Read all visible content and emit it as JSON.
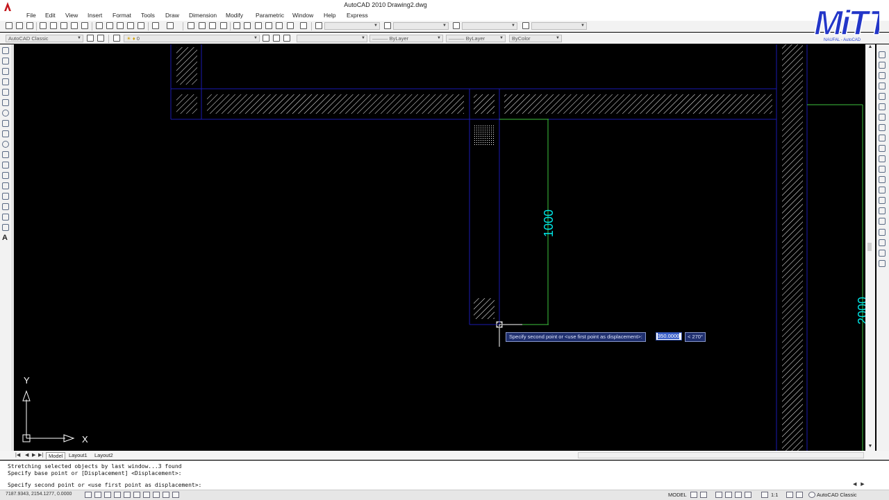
{
  "window": {
    "title": "AutoCAD 2010    Drawing2.dwg"
  },
  "menu": [
    "File",
    "Edit",
    "View",
    "Insert",
    "Format",
    "Tools",
    "Draw",
    "Dimension",
    "Modify",
    "Parametric",
    "Window",
    "Help",
    "Express"
  ],
  "toolbar": {
    "workspace": "AutoCAD Classic",
    "layer": "0",
    "linetype1": "ByLayer",
    "linetype2": "ByLayer",
    "color": "ByColor"
  },
  "logo": {
    "text": "MiTT",
    "subtitle": "NAUFAL - AutoCAD"
  },
  "drawing": {
    "dim_vertical": "1000",
    "dim_right": "2000",
    "ucs_x": "X",
    "ucs_y": "Y"
  },
  "dynamic_input": {
    "prompt": "Specify second point or <use first point as displacement>:",
    "distance": "350.0000",
    "angle": "< 270°"
  },
  "tabs": [
    "Model",
    "Layout1",
    "Layout2"
  ],
  "command_history": [
    "Stretching selected objects by last window...3 found",
    "Specify base point or [Displacement] <Displacement>:"
  ],
  "command_prompt": "Specify second point or <use first point as displacement>:",
  "status": {
    "coordinates": "7187.9343, 2154.1277, 0.0000",
    "space": "MODEL",
    "annotation_scale": "1:1",
    "workspace": "AutoCAD Classic"
  },
  "colors": {
    "wall_outline": "#1a1ab0",
    "hatch": "#ffffff",
    "dimension": "#00e5e5",
    "extension_line": "#3ec33e"
  }
}
